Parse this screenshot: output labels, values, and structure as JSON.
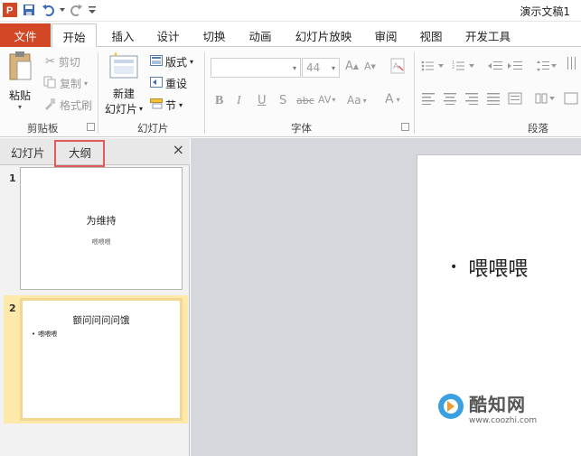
{
  "app": {
    "title": "演示文稿1"
  },
  "tabs": [
    "文件",
    "开始",
    "插入",
    "设计",
    "切换",
    "动画",
    "幻灯片放映",
    "审阅",
    "视图",
    "开发工具"
  ],
  "ribbon": {
    "clipboard": {
      "paste": "粘贴",
      "cut": "剪切",
      "copy": "复制",
      "format_painter": "格式刷",
      "label": "剪贴板"
    },
    "slides": {
      "new_slide_line1": "新建",
      "new_slide_line2": "幻灯片",
      "layout": "版式",
      "reset": "重设",
      "section": "节",
      "label": "幻灯片"
    },
    "font": {
      "size": "44",
      "label": "字体",
      "bold": "B",
      "italic": "I",
      "underline": "U",
      "shadow": "S",
      "strike": "abc",
      "spacing": "AV",
      "case": "Aa",
      "color": "A"
    },
    "paragraph": {
      "label": "段落"
    }
  },
  "left_pane": {
    "tab_slides": "幻灯片",
    "tab_outline": "大纲",
    "close": "×",
    "slides": [
      {
        "num": "1",
        "title": "为维持",
        "subtitle": "喂喂喂"
      },
      {
        "num": "2",
        "title": "额问问问问饿",
        "bullet": "喂喂喂"
      }
    ]
  },
  "slide": {
    "bullet_text": "喂喂喂"
  },
  "watermark": {
    "name": "酷知网",
    "url": "www.coozhi.com"
  },
  "colors": {
    "file_tab": "#d24726",
    "highlight": "#e05a5a",
    "selection": "#fde9a9"
  }
}
